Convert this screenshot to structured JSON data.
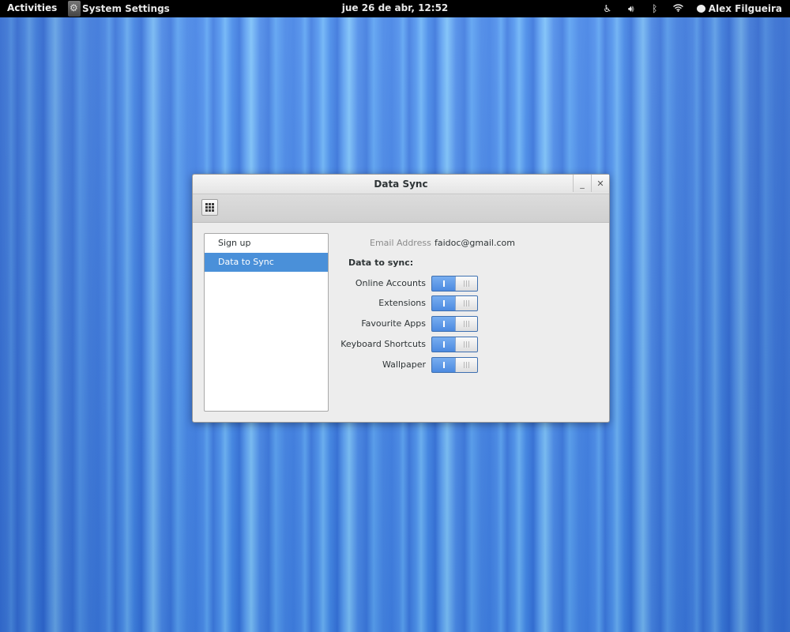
{
  "topbar": {
    "activities": "Activities",
    "app_name": "System Settings",
    "clock": "jue 26 de abr, 12:52",
    "user_name": "Alex Filgueira",
    "status_icons": [
      "accessibility-icon",
      "volume-icon",
      "bluetooth-icon",
      "wifi-icon"
    ]
  },
  "window": {
    "title": "Data Sync",
    "minimize_glyph": "_",
    "close_glyph": "✕"
  },
  "sidebar": {
    "items": [
      {
        "label": "Sign up",
        "selected": false
      },
      {
        "label": "Data to Sync",
        "selected": true
      }
    ]
  },
  "content": {
    "email_label": "Email Address",
    "email_value": "faidoc@gmail.com",
    "sync_heading": "Data to sync:",
    "sync_items": [
      {
        "label": "Online Accounts",
        "state": "on"
      },
      {
        "label": "Extensions",
        "state": "on"
      },
      {
        "label": "Favourite Apps",
        "state": "on"
      },
      {
        "label": "Keyboard Shortcuts",
        "state": "on"
      },
      {
        "label": "Wallpaper",
        "state": "on"
      }
    ]
  },
  "colors": {
    "accent": "#4a90d9",
    "topbar_bg": "#000000",
    "window_bg": "#ededed"
  }
}
